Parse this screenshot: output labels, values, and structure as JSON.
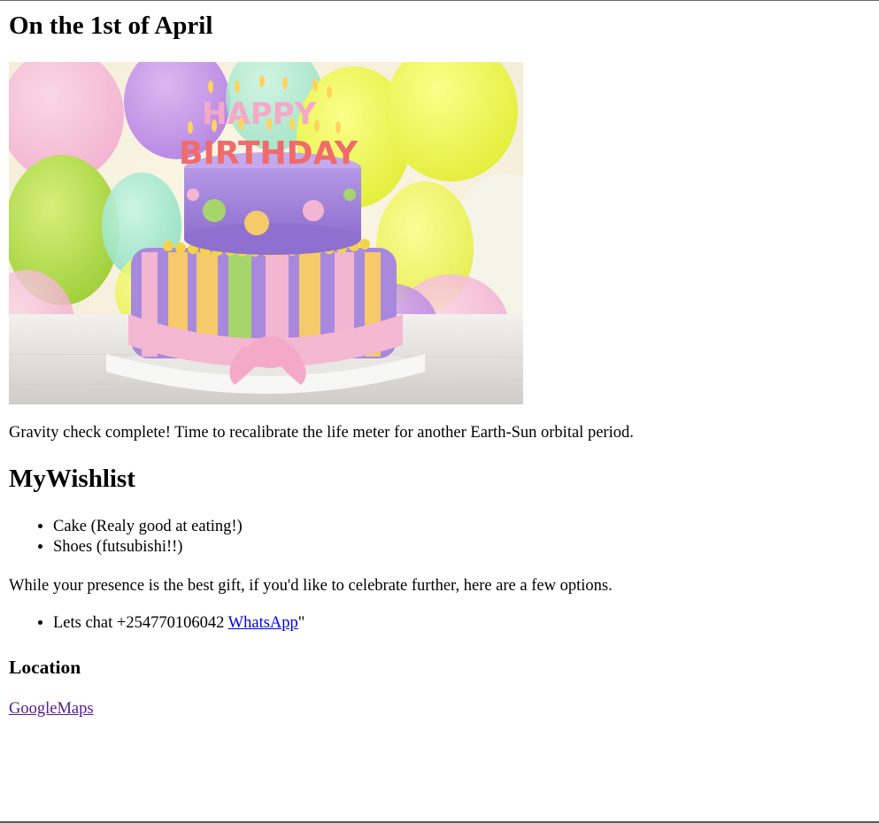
{
  "page": {
    "title": "On the 1st of April",
    "hero_image": {
      "cake_text_top": "HAPPY",
      "cake_text_bottom": "BIRTHDAY"
    },
    "tagline": "Gravity check complete! Time to recalibrate the life meter for another Earth-Sun orbital period."
  },
  "wishlist": {
    "heading": "MyWishlist",
    "items": [
      "Cake (Realy good at eating!)",
      "Shoes (futsubishi!!)"
    ]
  },
  "gifts": {
    "note": "While your presence is the best gift, if you'd like to celebrate further, here are a few options.",
    "contact_prefix": "Lets chat +254770106042 ",
    "contact_link": "WhatsApp",
    "contact_suffix": "\""
  },
  "location": {
    "heading": "Location",
    "maps_link": "GoogleMaps"
  },
  "colors": {
    "link": "#0000ee",
    "visited_link": "#551a8b"
  }
}
